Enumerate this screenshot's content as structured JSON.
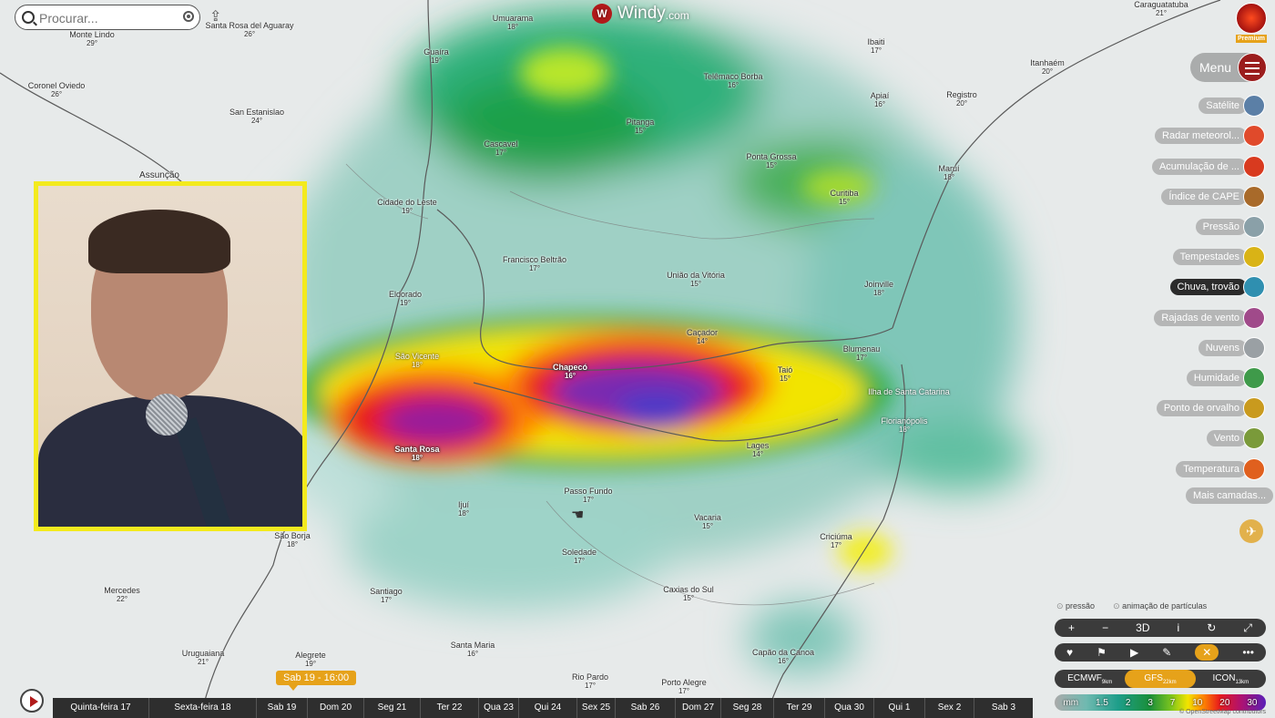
{
  "search": {
    "placeholder": "Procurar..."
  },
  "brand": {
    "name": "Windy",
    "domain": ".com",
    "badge": "Premium"
  },
  "menu": {
    "label": "Menu"
  },
  "layers": [
    {
      "label": "Satélite",
      "color": "#5b7fa6"
    },
    {
      "label": "Radar meteorol...",
      "color": "#e04a2b"
    },
    {
      "label": "Acumulação de ...",
      "color": "#d83a1f"
    },
    {
      "label": "Índice de CAPE",
      "color": "#a86a2a"
    },
    {
      "label": "Pressão",
      "color": "#8aa0a8"
    },
    {
      "label": "Tempestades",
      "color": "#d9b316"
    },
    {
      "label": "Chuva, trovão",
      "color": "#2f8fb0",
      "active": true
    },
    {
      "label": "Rajadas de vento",
      "color": "#a04a8a"
    },
    {
      "label": "Nuvens",
      "color": "#9aa0a4"
    },
    {
      "label": "Humidade",
      "color": "#3f9a4a"
    },
    {
      "label": "Ponto de orvalho",
      "color": "#c99a1e"
    },
    {
      "label": "Vento",
      "color": "#7a9a3a"
    },
    {
      "label": "Temperatura",
      "color": "#e0601e"
    }
  ],
  "more_layers": "Mais camadas...",
  "overlays": [
    "pressão",
    "animação de partículas"
  ],
  "controls": [
    "+",
    "−",
    "3D",
    "i",
    "↻",
    "⤢"
  ],
  "controls2": [
    "♥",
    "⚑",
    "▶",
    "✎",
    "✕",
    "•••"
  ],
  "models": [
    {
      "name": "ECMWF",
      "res": "9km"
    },
    {
      "name": "GFS",
      "res": "22km",
      "active": true
    },
    {
      "name": "ICON",
      "res": "13km"
    }
  ],
  "legend": [
    "mm",
    "1.5",
    "2",
    "3",
    "7",
    "10",
    "20",
    "30"
  ],
  "time_badge": "Sab 19 - 16:00",
  "timeline": [
    "Quinta-feira 17",
    "Sexta-feira 18",
    "Sab 19",
    "Dom 20",
    "Seg 21",
    "Ter 22",
    "Qua 23",
    "Qui 24",
    "Sex 25",
    "Sab 26",
    "Dom 27",
    "Seg 28",
    "Ter 29",
    "Qua 30",
    "Qui 1",
    "Sex 2",
    "Sab 3"
  ],
  "credit": "© OpenStreetMap contributors",
  "cities": [
    {
      "n": "Umuarama",
      "t": "18°"
    },
    {
      "n": "Guaíra",
      "t": "19°"
    },
    {
      "n": "Telêmaco Borba",
      "t": "16°"
    },
    {
      "n": "Ibaiti",
      "t": "17°"
    },
    {
      "n": "Itanhaém",
      "t": "20°"
    },
    {
      "n": "Caraguatatuba",
      "t": "21°"
    },
    {
      "n": "Monte Lindo",
      "t": "29°"
    },
    {
      "n": "Santa Rosa del Aguaray",
      "t": "26°"
    },
    {
      "n": "Coronel Oviedo",
      "t": "26°"
    },
    {
      "n": "San Estanislao",
      "t": "24°"
    },
    {
      "n": "Assunção",
      "t": ""
    },
    {
      "n": "Cascavel",
      "t": "17°"
    },
    {
      "n": "Pitanga",
      "t": "15°"
    },
    {
      "n": "Ponta Grossa",
      "t": "15°"
    },
    {
      "n": "Apiaí",
      "t": "16°"
    },
    {
      "n": "Registro",
      "t": "20°"
    },
    {
      "n": "Curitiba",
      "t": "15°"
    },
    {
      "n": "Cidade do Leste",
      "t": "19°"
    },
    {
      "n": "Francisco Beltrão",
      "t": "17°"
    },
    {
      "n": "União da Vitória",
      "t": "15°"
    },
    {
      "n": "Joinville",
      "t": "18°"
    },
    {
      "n": "Eldorado",
      "t": "19°"
    },
    {
      "n": "Caçador",
      "t": "14°"
    },
    {
      "n": "São Vicente",
      "t": "18°"
    },
    {
      "n": "Chapecó",
      "t": "16°"
    },
    {
      "n": "Taió",
      "t": "15°"
    },
    {
      "n": "Blumenau",
      "t": "17°"
    },
    {
      "n": "Ilha de Santa Catarina",
      "t": ""
    },
    {
      "n": "Florianópolis",
      "t": "18°"
    },
    {
      "n": "Santa Rosa",
      "t": "18°"
    },
    {
      "n": "Lages",
      "t": "14°"
    },
    {
      "n": "Passo Fundo",
      "t": "17°"
    },
    {
      "n": "Ijuí",
      "t": "18°"
    },
    {
      "n": "Vacaria",
      "t": "15°"
    },
    {
      "n": "Criciúma",
      "t": "17°"
    },
    {
      "n": "São Borja",
      "t": "18°"
    },
    {
      "n": "Soledade",
      "t": "17°"
    },
    {
      "n": "Mercedes",
      "t": "22°"
    },
    {
      "n": "Santiago",
      "t": "17°"
    },
    {
      "n": "Caxias do Sul",
      "t": "15°"
    },
    {
      "n": "Uruguaiana",
      "t": "21°"
    },
    {
      "n": "Alegrete",
      "t": "19°"
    },
    {
      "n": "Santa Maria",
      "t": "16°"
    },
    {
      "n": "Capão da Canoa",
      "t": "16°"
    },
    {
      "n": "Rio Pardo",
      "t": "17°"
    },
    {
      "n": "Porto Alegre",
      "t": "17°"
    },
    {
      "n": "Maruí",
      "t": "18°"
    }
  ]
}
